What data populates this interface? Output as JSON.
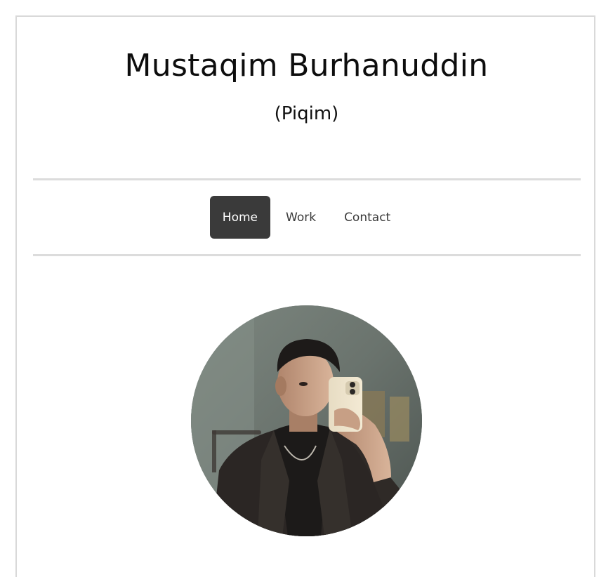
{
  "header": {
    "title": "Mustaqim Burhanuddin",
    "subtitle": "(Piqim)"
  },
  "nav": {
    "items": [
      {
        "label": "Home",
        "active": true
      },
      {
        "label": "Work",
        "active": false
      },
      {
        "label": "Contact",
        "active": false
      }
    ]
  },
  "colors": {
    "nav_active_bg": "#3a3a3a",
    "divider": "#dcdcdc",
    "frame_border": "#d9d9d9"
  },
  "profile": {
    "image": "profile-photo-mirror-selfie"
  }
}
